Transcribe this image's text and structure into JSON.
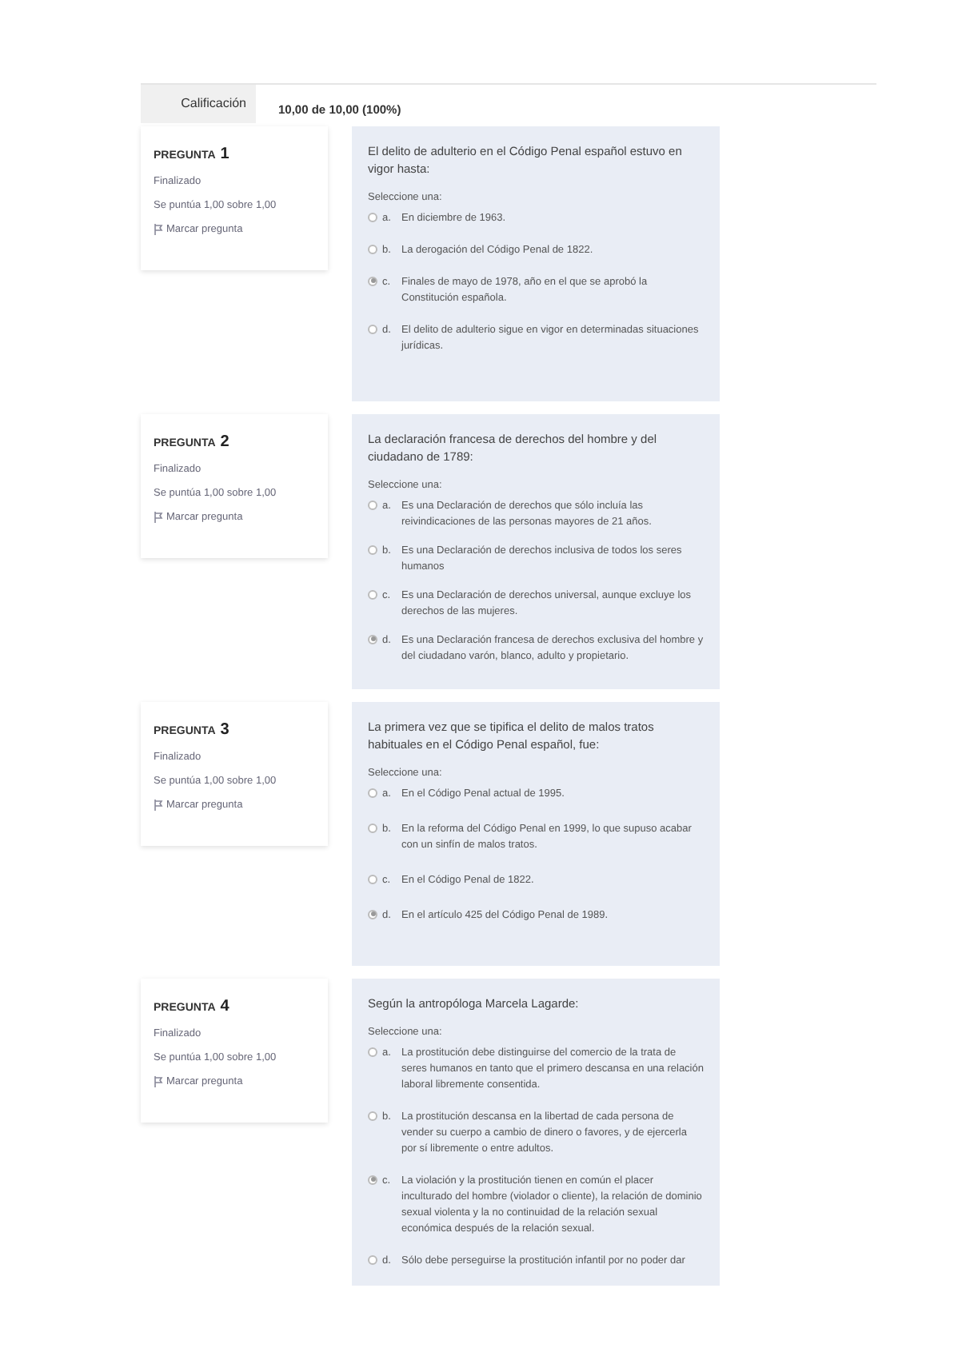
{
  "grade": {
    "label": "Calificación",
    "value": "10,00 de 10,00 (100%)"
  },
  "questions": [
    {
      "label": "PREGUNTA",
      "number": "1",
      "status": "Finalizado",
      "score": "Se puntúa 1,00 sobre 1,00",
      "flag": "Marcar pregunta",
      "text": "El delito de adulterio en el Código Penal español estuvo en vigor hasta:",
      "prompt": "Seleccione una:",
      "options": [
        {
          "letter": "a.",
          "text": "En diciembre de 1963.",
          "selected": false
        },
        {
          "letter": "b.",
          "text": "La derogación del Código Penal de 1822.",
          "selected": false
        },
        {
          "letter": "c.",
          "text": "Finales de mayo de 1978, año en el que se aprobó la Constitución española.",
          "selected": true
        },
        {
          "letter": "d.",
          "text": "El delito de adulterio sigue en vigor en determinadas situaciones jurídicas.",
          "selected": false
        }
      ]
    },
    {
      "label": "PREGUNTA",
      "number": "2",
      "status": "Finalizado",
      "score": "Se puntúa 1,00 sobre 1,00",
      "flag": "Marcar pregunta",
      "text": "La declaración francesa de derechos del hombre y del ciudadano de 1789:",
      "prompt": "Seleccione una:",
      "options": [
        {
          "letter": "a.",
          "text": "Es una Declaración de derechos que sólo incluía las reivindicaciones de las personas mayores de 21 años.",
          "selected": false
        },
        {
          "letter": "b.",
          "text": "Es una Declaración de derechos inclusiva de todos los seres humanos",
          "selected": false
        },
        {
          "letter": "c.",
          "text": "Es una Declaración de derechos universal, aunque excluye los derechos de las mujeres.",
          "selected": false
        },
        {
          "letter": "d.",
          "text": "Es una Declaración francesa de derechos exclusiva del hombre y del ciudadano varón, blanco, adulto y propietario.",
          "selected": true
        }
      ]
    },
    {
      "label": "PREGUNTA",
      "number": "3",
      "status": "Finalizado",
      "score": "Se puntúa 1,00 sobre 1,00",
      "flag": "Marcar pregunta",
      "text": "La primera vez que se tipifica el delito de malos tratos habituales en el Código Penal español, fue:",
      "prompt": "Seleccione una:",
      "options": [
        {
          "letter": "a.",
          "text": "En el Código Penal actual de 1995.",
          "selected": false
        },
        {
          "letter": "b.",
          "text": "En la reforma del Código Penal en 1999, lo que supuso acabar con un sinfín de malos tratos.",
          "selected": false
        },
        {
          "letter": "c.",
          "text": "En el Código Penal de 1822.",
          "selected": false
        },
        {
          "letter": "d.",
          "text": "En el artículo 425 del Código Penal de 1989.",
          "selected": true
        }
      ]
    },
    {
      "label": "PREGUNTA",
      "number": "4",
      "status": "Finalizado",
      "score": "Se puntúa 1,00 sobre 1,00",
      "flag": "Marcar pregunta",
      "text": "Según la antropóloga Marcela Lagarde:",
      "prompt": "Seleccione una:",
      "options": [
        {
          "letter": "a.",
          "text": "La prostitución debe distinguirse del comercio de la trata de seres humanos en tanto que el primero descansa en una relación laboral libremente consentida.",
          "selected": false
        },
        {
          "letter": "b.",
          "text": "La prostitución descansa en la libertad de cada persona de vender su cuerpo a cambio de dinero o favores, y de ejercerla por sí libremente o entre adultos.",
          "selected": false
        },
        {
          "letter": "c.",
          "text": "La violación y la prostitución tienen en común el placer inculturado del hombre (violador o cliente), la relación de dominio sexual violenta y la no continuidad de la relación sexual económica después de la relación sexual.",
          "selected": true
        },
        {
          "letter": "d.",
          "text": "Sólo debe perseguirse la prostitución infantil por no poder dar",
          "selected": false
        }
      ]
    }
  ]
}
